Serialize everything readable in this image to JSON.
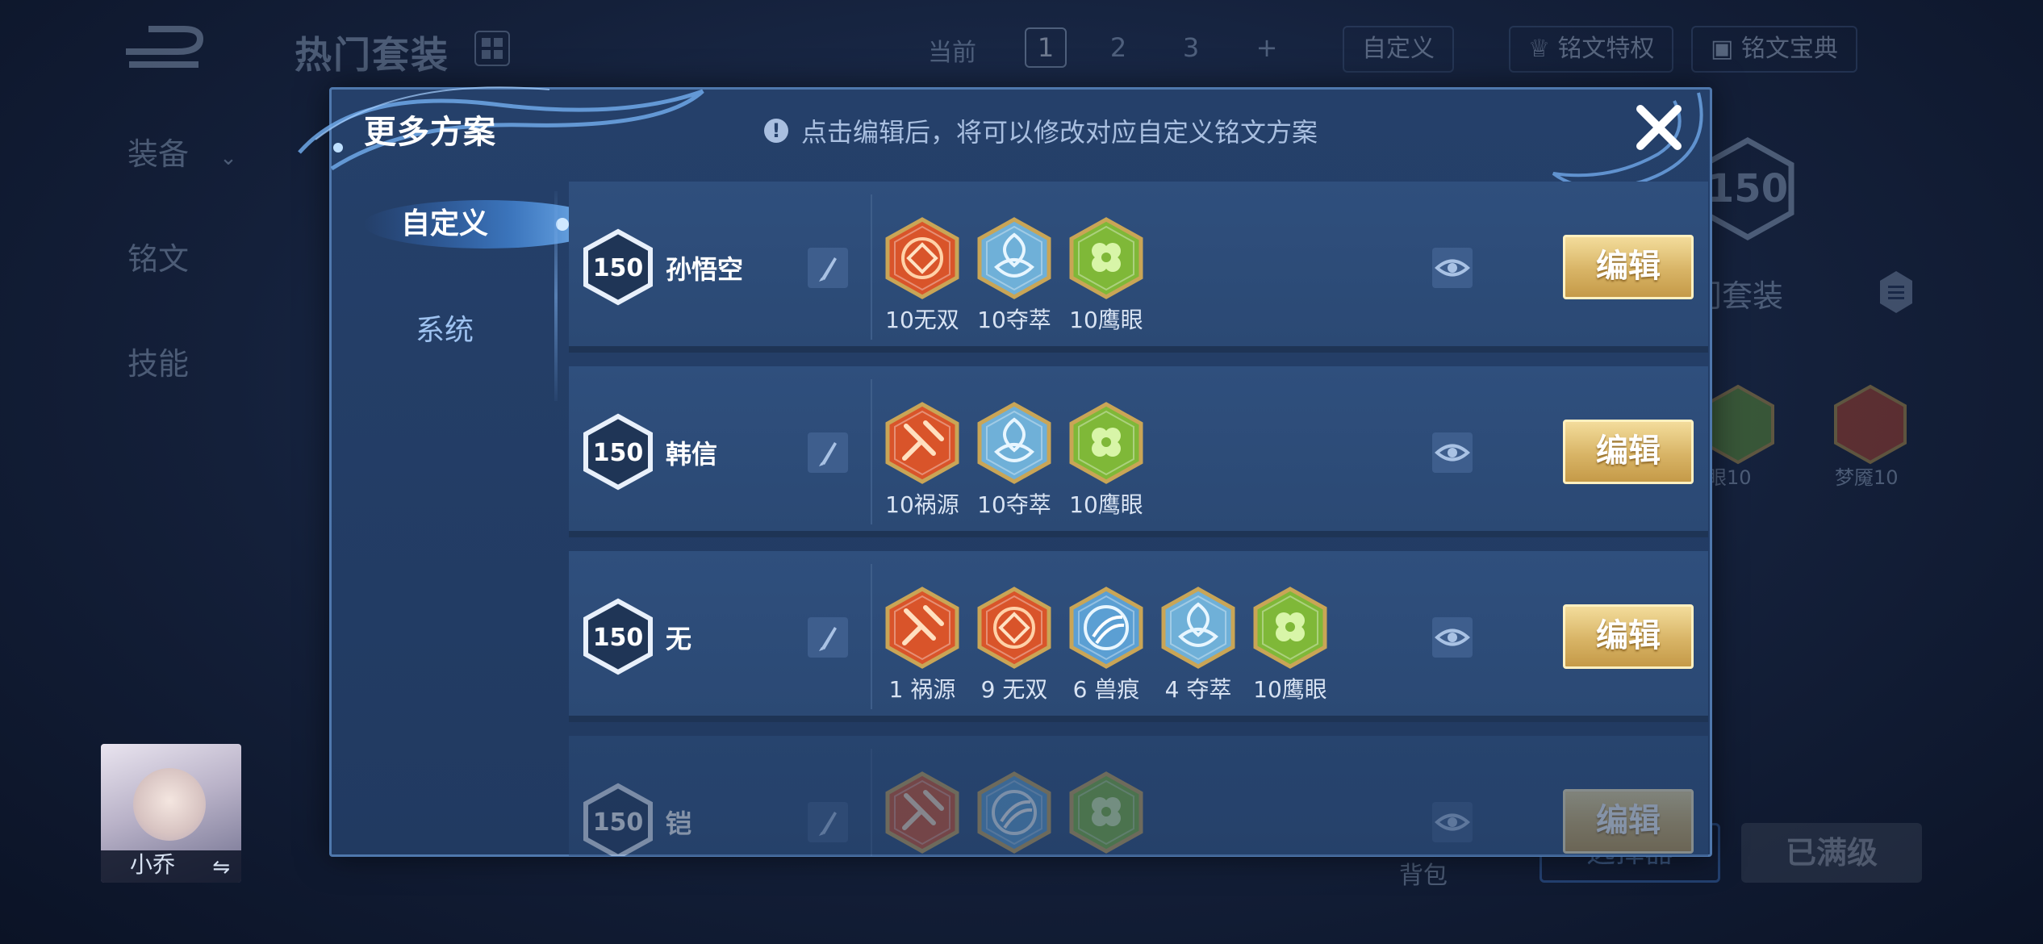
{
  "background": {
    "title": "热门套装",
    "sidebar": [
      {
        "label": "装备",
        "chevron": "chevron-down-icon"
      },
      {
        "label": "铭文"
      },
      {
        "label": "技能"
      }
    ],
    "page_label": "当前",
    "pages": [
      "1",
      "2",
      "3",
      "+"
    ],
    "active_page": "1",
    "custom_label": "自定义",
    "privilege_label": "铭文特权",
    "guide_label": "铭文宝典",
    "right_level": "150",
    "right_label": "门套装",
    "right_runes": [
      {
        "label": "眼10",
        "color": "#6aa033"
      },
      {
        "label": "梦魇10",
        "color": "#c0452a"
      }
    ],
    "avatar_name": "小乔",
    "avatar_swap_icon": "⇋",
    "bag_label": "背包",
    "select_button": "选择器",
    "maxed_button": "已满级"
  },
  "modal": {
    "title": "更多方案",
    "notice_icon": "!",
    "notice": "点击编辑后，将可以修改对应自定义铭文方案",
    "close_icon": "close-icon",
    "tabs": [
      {
        "label": "自定义",
        "active": true
      },
      {
        "label": "系统",
        "active": false
      }
    ],
    "rows": [
      {
        "level": "150",
        "name": "孙悟空",
        "runes": [
          {
            "type": "red-swirl",
            "label": "10无双",
            "color": "#d9542a"
          },
          {
            "type": "blue-knot",
            "label": "10夺萃",
            "color": "#6fb0d8"
          },
          {
            "type": "green-clover",
            "label": "10鹰眼",
            "color": "#7fb838"
          }
        ],
        "edit": "编辑"
      },
      {
        "level": "150",
        "name": "韩信",
        "runes": [
          {
            "type": "red-hammer",
            "label": "10祸源",
            "color": "#d9542a"
          },
          {
            "type": "blue-knot",
            "label": "10夺萃",
            "color": "#6fb0d8"
          },
          {
            "type": "green-clover",
            "label": "10鹰眼",
            "color": "#7fb838"
          }
        ],
        "edit": "编辑"
      },
      {
        "level": "150",
        "name": "无",
        "runes": [
          {
            "type": "red-hammer",
            "label": "1 祸源",
            "color": "#d9542a"
          },
          {
            "type": "red-swirl",
            "label": "9 无双",
            "color": "#d9542a"
          },
          {
            "type": "blue-claw",
            "label": "6 兽痕",
            "color": "#5b9fd3"
          },
          {
            "type": "blue-knot",
            "label": "4 夺萃",
            "color": "#6fb0d8"
          },
          {
            "type": "green-clover",
            "label": "10鹰眼",
            "color": "#7fb838"
          }
        ],
        "edit": "编辑"
      },
      {
        "level": "150",
        "name": "铠",
        "runes": [
          {
            "type": "red-hammer",
            "label": "",
            "color": "#d9542a"
          },
          {
            "type": "blue-claw",
            "label": "",
            "color": "#5b9fd3"
          },
          {
            "type": "green-clover",
            "label": "",
            "color": "#7fb838"
          }
        ],
        "edit": "编辑"
      }
    ]
  }
}
